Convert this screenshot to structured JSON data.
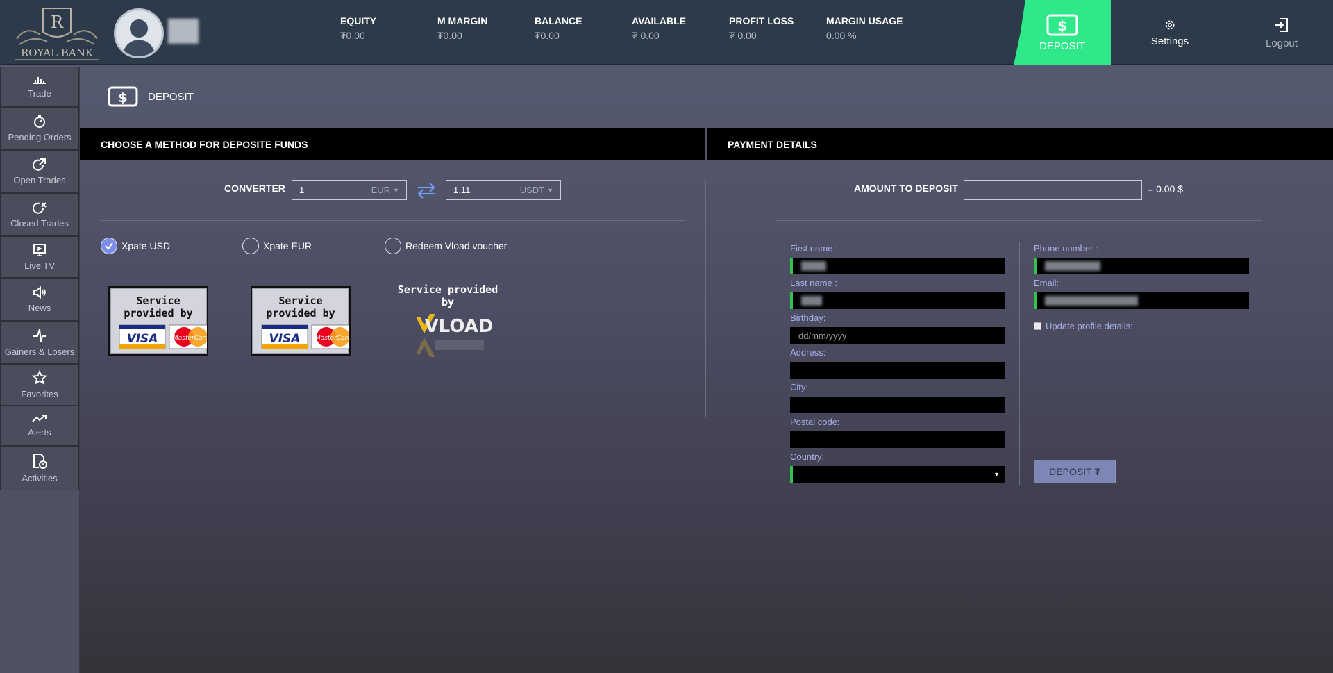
{
  "brand": {
    "name": "ROYAL BANK",
    "initial": "R"
  },
  "header": {
    "stats": [
      {
        "label": "EQUITY",
        "value": "₮0.00"
      },
      {
        "label": "M MARGIN",
        "value": "₮0.00"
      },
      {
        "label": "BALANCE",
        "value": "₮0.00"
      },
      {
        "label": "AVAILABLE",
        "value": "₮ 0.00"
      },
      {
        "label": "PROFIT LOSS",
        "value": "₮ 0.00"
      },
      {
        "label": "MARGIN USAGE",
        "value": "0.00 %"
      }
    ],
    "deposit_label": "DEPOSIT",
    "settings_label": "Settings",
    "logout_label": "Logout"
  },
  "sidebar": {
    "items": [
      {
        "label": "Trade",
        "icon": "chart-bars-icon"
      },
      {
        "label": "Pending Orders",
        "icon": "stopwatch-icon"
      },
      {
        "label": "Open Trades",
        "icon": "open-trade-icon"
      },
      {
        "label": "Closed Trades",
        "icon": "closed-trade-icon"
      },
      {
        "label": "Live TV",
        "icon": "tv-icon"
      },
      {
        "label": "News",
        "icon": "speaker-icon"
      },
      {
        "label": "Gainers & Losers",
        "icon": "pulse-icon"
      },
      {
        "label": "Favorites",
        "icon": "star-icon"
      },
      {
        "label": "Alerts",
        "icon": "trend-alert-icon"
      },
      {
        "label": "Activities",
        "icon": "document-clock-icon"
      }
    ]
  },
  "page": {
    "title": "DEPOSIT"
  },
  "methods": {
    "header": "CHOOSE A METHOD FOR DEPOSITE FUNDS",
    "converter": {
      "label": "CONVERTER",
      "from_value": "1",
      "from_currency": "EUR",
      "to_value": "1,11",
      "to_currency": "USDT"
    },
    "options": [
      {
        "label": "Xpate USD",
        "selected": true
      },
      {
        "label": "Xpate EUR",
        "selected": false
      },
      {
        "label": "Redeem Vload voucher",
        "selected": false
      }
    ],
    "cards": [
      {
        "service_text": "Service provided by",
        "brands": [
          "VISA",
          "MasterCard"
        ]
      },
      {
        "service_text": "Service provided by",
        "brands": [
          "VISA",
          "MasterCard"
        ]
      },
      {
        "service_text": "Service provided by",
        "brands": [
          "VLOAD"
        ]
      }
    ]
  },
  "payment": {
    "header": "PAYMENT DETAILS",
    "amount_label": "AMOUNT TO DEPOSIT",
    "amount_value": "",
    "amount_equals": "= 0.00 $",
    "fields_left": [
      {
        "label": "First name :",
        "placeholder": "",
        "filled": true
      },
      {
        "label": "Last name :",
        "placeholder": "",
        "filled": true
      },
      {
        "label": "Birthday:",
        "placeholder": "dd/mm/yyyy",
        "filled": false
      },
      {
        "label": "Address:",
        "placeholder": "",
        "filled": false
      },
      {
        "label": "City:",
        "placeholder": "",
        "filled": false
      },
      {
        "label": "Postal code:",
        "placeholder": "",
        "filled": false
      },
      {
        "label": "Country:",
        "placeholder": "",
        "filled": false
      }
    ],
    "fields_right": [
      {
        "label": "Phone number :",
        "filled": true
      },
      {
        "label": "Email:",
        "filled": true
      }
    ],
    "update_profile_label": "Update profile details:",
    "deposit_button_label": "DEPOSIT ₮"
  },
  "colors": {
    "accent": "#2ee88a",
    "topbar": "#2d3a49",
    "label_purple": "#a7b1ea",
    "button": "#7c87b5"
  }
}
